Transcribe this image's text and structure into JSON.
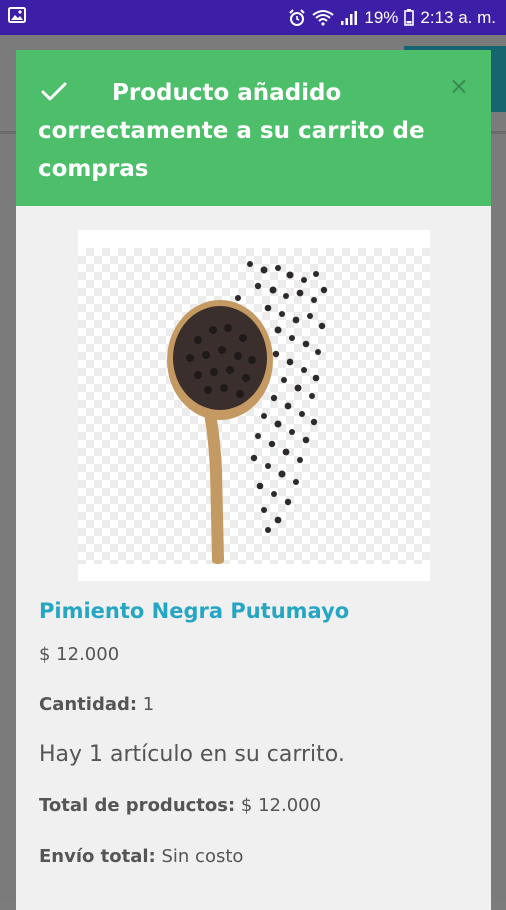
{
  "status_bar": {
    "battery_percent": "19%",
    "time": "2:13 a. m.",
    "icons": [
      "gallery-icon",
      "alarm-icon",
      "wifi-icon",
      "signal-icon",
      "battery-icon"
    ]
  },
  "modal": {
    "title": "Producto añadido correctamente a su carrito de compras",
    "close_label": "×",
    "header_color": "#4dbf6b"
  },
  "product": {
    "name": "Pimiento Negra Putumayo",
    "price": "$ 12.000",
    "quantity_label": "Cantidad:",
    "quantity_value": "1",
    "name_color": "#27a6c4"
  },
  "cart": {
    "message": "Hay 1 artículo en su carrito.",
    "total_label": "Total de productos:",
    "total_value": "$ 12.000",
    "shipping_label": "Envío total:",
    "shipping_value": "Sin costo"
  }
}
